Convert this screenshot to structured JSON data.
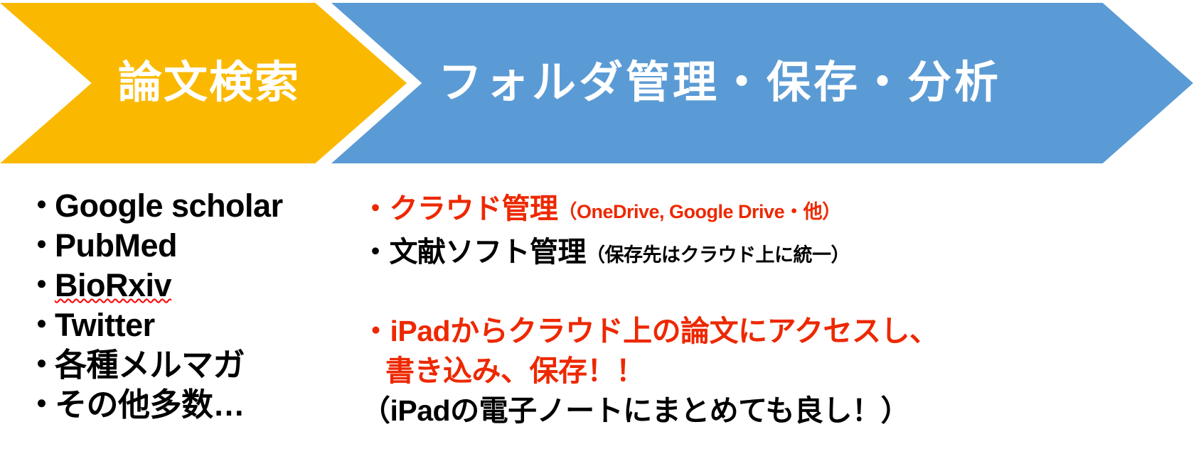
{
  "banners": [
    {
      "id": "search",
      "label": "論文検索",
      "color": "#FAB900",
      "text_color": "#FFFFFF"
    },
    {
      "id": "manage",
      "label": "フォルダ管理・保存・分析",
      "color": "#5B9BD5",
      "text_color": "#FFFFFF"
    }
  ],
  "search_sources": {
    "bullet": "・",
    "items": [
      {
        "label": "Google scholar",
        "misspelled": false
      },
      {
        "label": "PubMed",
        "misspelled": false
      },
      {
        "label": "BioRxiv",
        "misspelled": true
      },
      {
        "label": "Twitter",
        "misspelled": false
      },
      {
        "label": "各種メルマガ",
        "misspelled": false
      },
      {
        "label": "その他多数…",
        "misspelled": false
      }
    ]
  },
  "manage_notes": {
    "line1_bullet": "・",
    "line1_main": "クラウド管理",
    "line1_sub": "（OneDrive, Google Drive・他）",
    "line1_color": "#ED2800",
    "line2_bullet": "・",
    "line2_main": "文献ソフト管理",
    "line2_sub": "（保存先はクラウド上に統一）",
    "line2_color": "#000000",
    "line3_a": "・iPadからクラウド上の論文にアクセスし、",
    "line3_b": "書き込み、保存！！",
    "line3_color": "#ED2800",
    "line4": "（iPadの電子ノートにまとめても良し！）",
    "line4_color": "#000000"
  }
}
